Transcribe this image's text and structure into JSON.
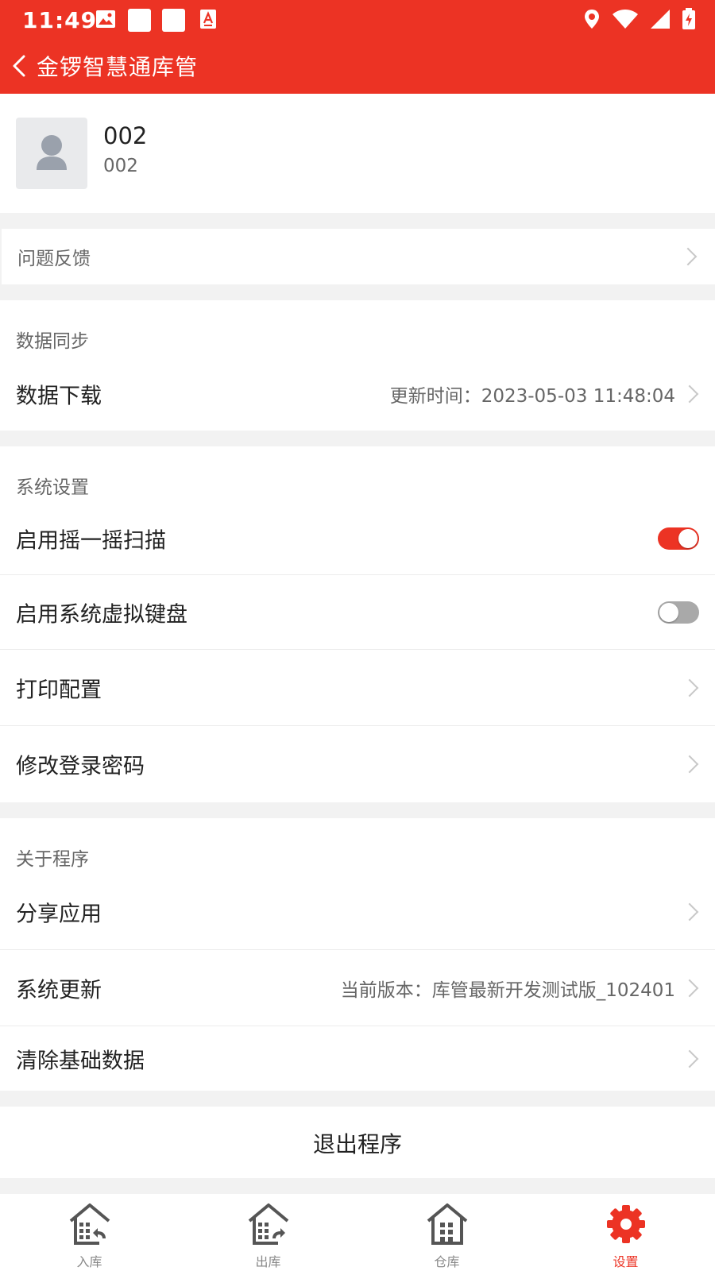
{
  "status_bar": {
    "time": "11:49"
  },
  "header": {
    "title": "金锣智慧通库管"
  },
  "profile": {
    "name": "002",
    "id": "002"
  },
  "feedback": {
    "label": "问题反馈"
  },
  "data_sync": {
    "heading": "数据同步",
    "download": {
      "label": "数据下载",
      "value": "更新时间：2023-05-03 11:48:04"
    }
  },
  "system_settings": {
    "heading": "系统设置",
    "shake_scan": {
      "label": "启用摇一摇扫描",
      "enabled": true
    },
    "virtual_keyboard": {
      "label": "启用系统虚拟键盘",
      "enabled": false
    },
    "print_config": {
      "label": "打印配置"
    },
    "change_password": {
      "label": "修改登录密码"
    }
  },
  "about": {
    "heading": "关于程序",
    "share": {
      "label": "分享应用"
    },
    "update": {
      "label": "系统更新",
      "value": "当前版本：库管最新开发测试版_102401"
    },
    "clear": {
      "label": "清除基础数据"
    }
  },
  "exit": {
    "label": "退出程序"
  },
  "bottom_nav": {
    "items": [
      {
        "label": "入库",
        "icon": "warehouse-in-icon"
      },
      {
        "label": "出库",
        "icon": "warehouse-out-icon"
      },
      {
        "label": "仓库",
        "icon": "warehouse-icon"
      },
      {
        "label": "设置",
        "icon": "gear-icon",
        "active": true
      }
    ]
  },
  "colors": {
    "accent": "#ec3324",
    "background": "#f2f2f2",
    "text": "#222222",
    "muted": "#666666"
  }
}
